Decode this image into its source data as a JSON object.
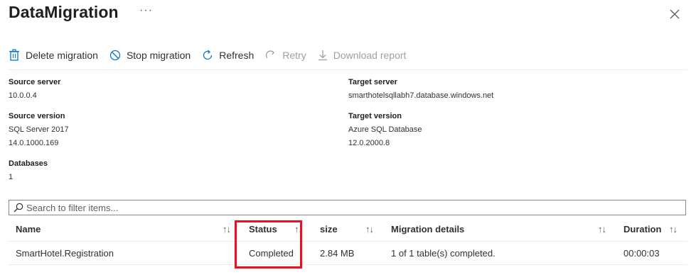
{
  "header": {
    "title": "DataMigration",
    "more": "···"
  },
  "toolbar": {
    "delete": "Delete migration",
    "stop": "Stop migration",
    "refresh": "Refresh",
    "retry": "Retry",
    "download": "Download report"
  },
  "details": {
    "source_server_label": "Source server",
    "source_server": "10.0.0.4",
    "source_version_label": "Source version",
    "source_version_name": "SQL Server 2017",
    "source_version_number": "14.0.1000.169",
    "databases_label": "Databases",
    "databases": "1",
    "target_server_label": "Target server",
    "target_server": "smarthotelsqllabh7.database.windows.net",
    "target_version_label": "Target version",
    "target_version_name": "Azure SQL Database",
    "target_version_number": "12.0.2000.8"
  },
  "search": {
    "placeholder": "Search to filter items..."
  },
  "table": {
    "columns": [
      "Name",
      "Status",
      "size",
      "Migration details",
      "Duration"
    ],
    "rows": [
      [
        "SmartHotel.Registration",
        "Completed",
        "2.84 MB",
        "1 of 1 table(s) completed.",
        "00:00:03"
      ]
    ]
  },
  "sort_glyph": "↑↓",
  "colors": {
    "accent": "#0078d4",
    "highlight": "#e81123"
  }
}
